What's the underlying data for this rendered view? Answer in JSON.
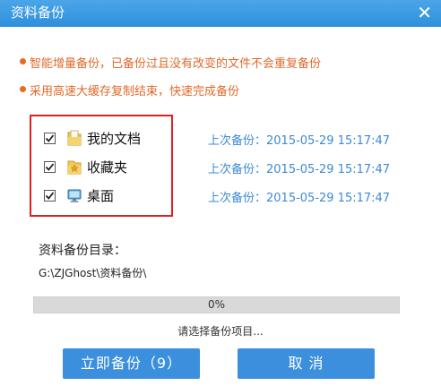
{
  "window": {
    "title": "资料备份",
    "close_glyph": "✕"
  },
  "tips": [
    "智能增量备份，已备份过且没有改变的文件不会重复备份",
    "采用高速大缓存复制结束，快速完成备份"
  ],
  "items": [
    {
      "label": "我的文档",
      "checked": true,
      "icon": "documents-folder-icon",
      "last_backup": "上次备份：2015-05-29 15:17:47"
    },
    {
      "label": "收藏夹",
      "checked": true,
      "icon": "favorites-folder-icon",
      "last_backup": "上次备份：2015-05-29 15:17:47"
    },
    {
      "label": "桌面",
      "checked": true,
      "icon": "desktop-icon",
      "last_backup": "上次备份：2015-05-29 15:17:47"
    }
  ],
  "directory": {
    "label": "资料备份目录：",
    "path": "G:\\ZJGhost\\资料备份\\"
  },
  "progress": {
    "percent_text": "0%",
    "value": 0
  },
  "status_text": "请选择备份项目...",
  "buttons": {
    "backup_label": "立即备份（9）",
    "cancel_label": "取  消"
  },
  "colors": {
    "accent": "#3b8fdc",
    "tip_text": "#e0692a",
    "highlight_box": "#e02020",
    "last_backup_text": "#3c8ad6"
  }
}
